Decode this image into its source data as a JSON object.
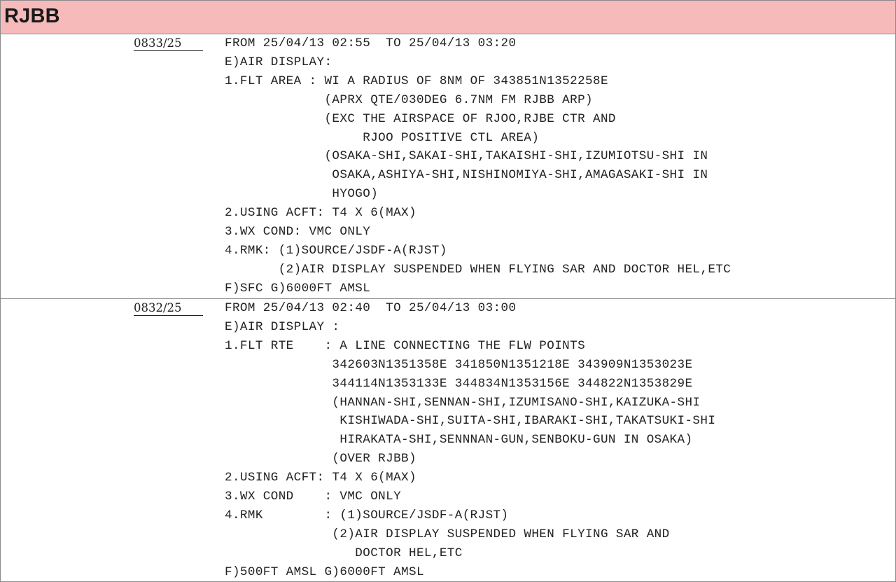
{
  "header": {
    "title": "RJBB"
  },
  "notams": [
    {
      "id": "0833/25",
      "lines": [
        "FROM 25/04/13 02:55  TO 25/04/13 03:20",
        "E)AIR DISPLAY:",
        "1.FLT AREA : WI A RADIUS OF 8NM OF 343851N1352258E",
        "             (APRX QTE/030DEG 6.7NM FM RJBB ARP)",
        "             (EXC THE AIRSPACE OF RJOO,RJBE CTR AND",
        "                  RJOO POSITIVE CTL AREA)",
        "             (OSAKA-SHI,SAKAI-SHI,TAKAISHI-SHI,IZUMIOTSU-SHI IN",
        "              OSAKA,ASHIYA-SHI,NISHINOMIYA-SHI,AMAGASAKI-SHI IN",
        "              HYOGO)",
        "2.USING ACFT: T4 X 6(MAX)",
        "3.WX COND: VMC ONLY",
        "4.RMK: (1)SOURCE/JSDF-A(RJST)",
        "       (2)AIR DISPLAY SUSPENDED WHEN FLYING SAR AND DOCTOR HEL,ETC",
        "F)SFC G)6000FT AMSL"
      ]
    },
    {
      "id": "0832/25",
      "lines": [
        "FROM 25/04/13 02:40  TO 25/04/13 03:00",
        "E)AIR DISPLAY :",
        "1.FLT RTE    : A LINE CONNECTING THE FLW POINTS",
        "              342603N1351358E 341850N1351218E 343909N1353023E",
        "              344114N1353133E 344834N1353156E 344822N1353829E",
        "              (HANNAN-SHI,SENNAN-SHI,IZUMISANO-SHI,KAIZUKA-SHI",
        "               KISHIWADA-SHI,SUITA-SHI,IBARAKI-SHI,TAKATSUKI-SHI",
        "               HIRAKATA-SHI,SENNNAN-GUN,SENBOKU-GUN IN OSAKA)",
        "              (OVER RJBB)",
        "2.USING ACFT: T4 X 6(MAX)",
        "3.WX COND    : VMC ONLY",
        "4.RMK        : (1)SOURCE/JSDF-A(RJST)",
        "              (2)AIR DISPLAY SUSPENDED WHEN FLYING SAR AND",
        "                 DOCTOR HEL,ETC",
        "F)500FT AMSL G)6000FT AMSL"
      ]
    }
  ],
  "colors": {
    "header_bg": "#f6babb",
    "border": "#8a8a8a",
    "text": "#222222"
  }
}
